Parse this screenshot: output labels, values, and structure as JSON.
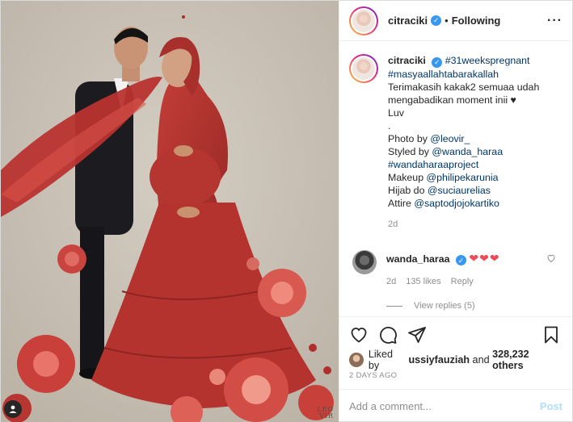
{
  "header": {
    "username": "citraciki",
    "separator": "•",
    "follow_status": "Following",
    "more_label": "···"
  },
  "caption": {
    "username": "citraciki",
    "hashtag1": "#31weekspregnant",
    "hashtag2": "#masyaallahtabarakallah",
    "line1": "Terimakasih kakak2 semuaa udah",
    "line2": "mengabadikan moment inii ♥",
    "line3": "Luv",
    "line4": ".",
    "photo_prefix": "Photo by ",
    "photo_handle": "@leovir_",
    "styled_prefix": "Styled by ",
    "styled_handle": "@wanda_haraa",
    "project_tag": "#wandaharaaproject",
    "makeup_prefix": "Makeup ",
    "makeup_handle": "@philipekarunia",
    "hijab_prefix": "Hijab do ",
    "hijab_handle": "@suciaurelias",
    "attire_prefix": "Attire ",
    "attire_handle": "@saptodjojokartiko",
    "time": "2d"
  },
  "comment": {
    "username": "wanda_haraa",
    "text": "❤❤❤",
    "time": "2d",
    "likes": "135 likes",
    "reply_label": "Reply",
    "view_replies": "View replies (5)"
  },
  "likes": {
    "prefix": "Liked by ",
    "user": "ussiyfauziah",
    "middle": " and ",
    "others": "328,232 others"
  },
  "date": "2 DAYS AGO",
  "add_comment": {
    "placeholder": "Add a comment...",
    "post_label": "Post"
  },
  "photo": {
    "watermark_line1": "LEO",
    "watermark_line2": "VIR"
  },
  "colors": {
    "verified": "#3897f0",
    "link": "#00376b",
    "post_disabled": "#b2dffc",
    "heart_red": "#ed4956"
  }
}
